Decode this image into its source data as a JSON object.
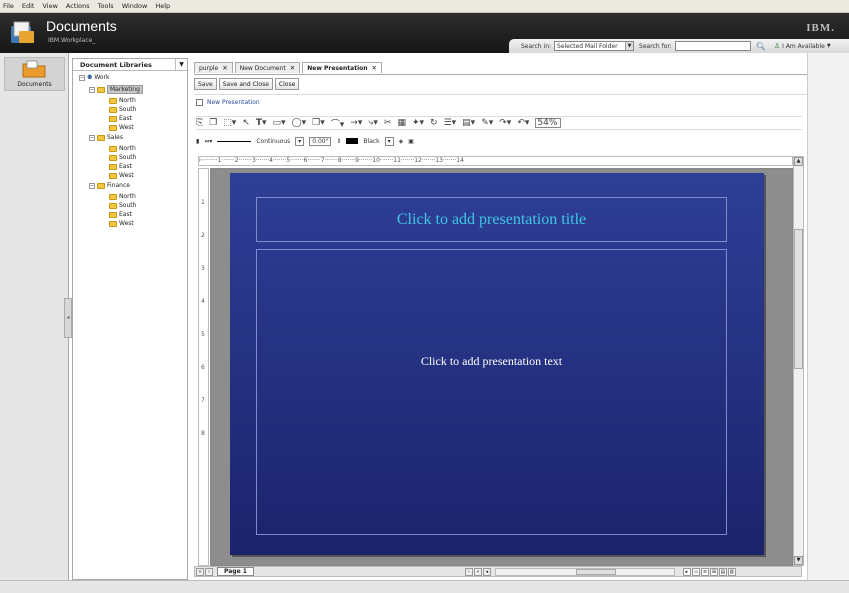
{
  "menubar": {
    "items": [
      "File",
      "Edit",
      "View",
      "Actions",
      "Tools",
      "Window",
      "Help"
    ]
  },
  "header": {
    "title": "Documents",
    "subtitle": "IBM.Workplace_",
    "brand": "IBM."
  },
  "search": {
    "search_in_label": "Search in:",
    "folder_value": "Selected Mail Folder",
    "search_for_label": "Search for:",
    "availability": "I Am Available"
  },
  "left_sidebar": {
    "items": [
      {
        "label": "Documents"
      }
    ]
  },
  "libraries": {
    "header": "Document Libraries",
    "root": "Work",
    "groups": [
      {
        "name": "Marketing",
        "children": [
          "North",
          "South",
          "East",
          "West"
        ]
      },
      {
        "name": "Sales",
        "children": [
          "North",
          "South",
          "East",
          "West"
        ]
      },
      {
        "name": "Finance",
        "children": [
          "North",
          "South",
          "East",
          "West"
        ]
      }
    ]
  },
  "tabs": [
    {
      "label": "purple"
    },
    {
      "label": "New Document"
    },
    {
      "label": "New Presentation"
    }
  ],
  "buttons": {
    "save": "Save",
    "save_close": "Save and Close",
    "close": "Close"
  },
  "breadcrumb": "New Presentation",
  "toolbar": {
    "zoom": "54%",
    "line_style": "Continuous",
    "line_width": "0.00\"",
    "color_name": "Black"
  },
  "ruler": {
    "horizontal_marks": [
      "1",
      "2",
      "3",
      "4",
      "5",
      "6",
      "7",
      "8",
      "9",
      "10",
      "11",
      "12",
      "13",
      "14"
    ],
    "vertical_marks": [
      "1",
      "2",
      "3",
      "4",
      "5",
      "6",
      "7",
      "8"
    ]
  },
  "slide": {
    "title_placeholder": "Click to add presentation title",
    "body_placeholder": "Click to add presentation text"
  },
  "pager": {
    "page_label": "Page 1"
  }
}
